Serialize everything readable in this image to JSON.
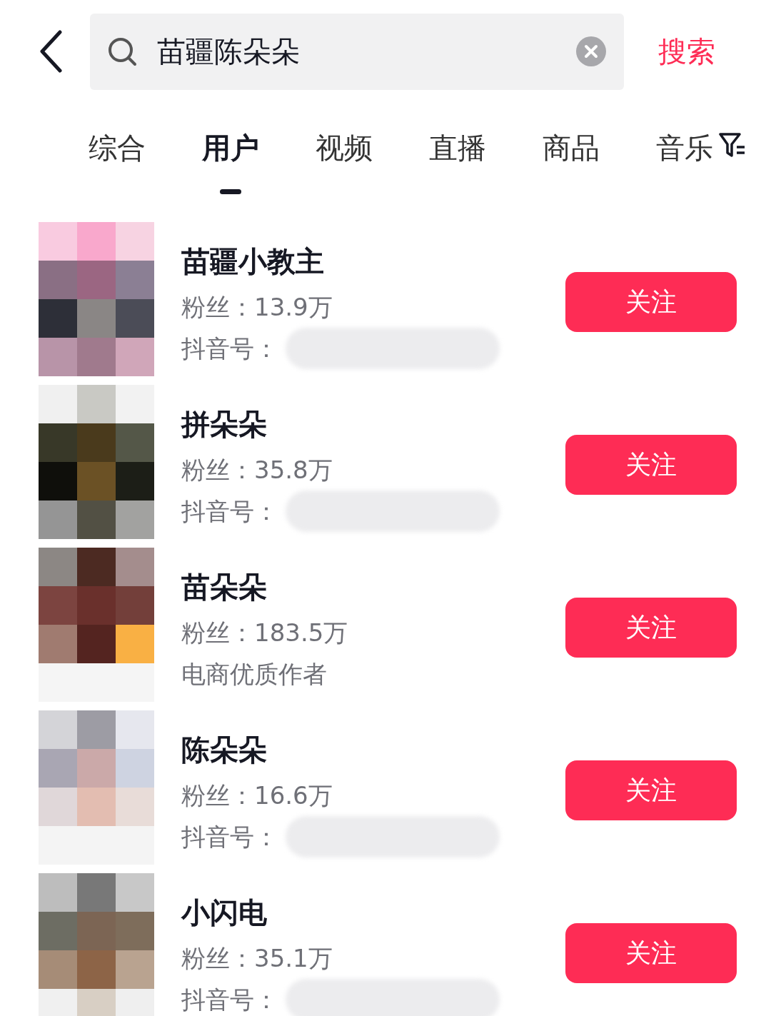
{
  "search": {
    "value": "苗疆陈朵朵",
    "action": "搜索"
  },
  "tabs": [
    {
      "label": "综合",
      "selected": false
    },
    {
      "label": "用户",
      "selected": true
    },
    {
      "label": "视频",
      "selected": false
    },
    {
      "label": "直播",
      "selected": false
    },
    {
      "label": "商品",
      "selected": false
    },
    {
      "label": "音乐",
      "selected": false
    }
  ],
  "users": [
    {
      "name": "苗疆小教主",
      "fans": "粉丝：13.9万",
      "kind": "handle",
      "detail": "抖音号：",
      "follow": "关注"
    },
    {
      "name": "拼朵朵",
      "fans": "粉丝：35.8万",
      "kind": "handle",
      "detail": "抖音号：",
      "follow": "关注"
    },
    {
      "name": "苗朵朵",
      "fans": "粉丝：183.5万",
      "kind": "tag",
      "detail": "电商优质作者",
      "follow": "关注"
    },
    {
      "name": "陈朵朵",
      "fans": "粉丝：16.6万",
      "kind": "handle",
      "detail": "抖音号：",
      "follow": "关注"
    },
    {
      "name": "小闪电",
      "fans": "粉丝：35.1万",
      "kind": "handle",
      "detail": "抖音号：",
      "follow": "关注"
    }
  ]
}
